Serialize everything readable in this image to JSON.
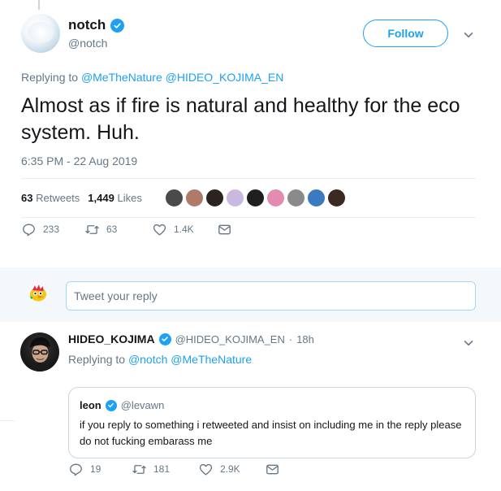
{
  "main_tweet": {
    "display_name": "notch",
    "handle": "@notch",
    "follow_label": "Follow",
    "replying_prefix": "Replying to",
    "replying_mentions": [
      "@MeTheNature",
      "@HIDEO_KOJIMA_EN"
    ],
    "text": "Almost as if fire is natural and healthy for the eco system. Huh.",
    "timestamp": "6:35 PM - 22 Aug 2019",
    "retweets_count": "63",
    "retweets_label": "Retweets",
    "likes_count": "1,449",
    "likes_label": "Likes",
    "reply_count": "233",
    "retweet_action_count": "63",
    "like_action_count": "1.4K",
    "liker_colors": [
      "#4a4a4a",
      "#b07a6a",
      "#2b2320",
      "#c9b8e0",
      "#1f1f1f",
      "#e38bb0",
      "#8a8a8a",
      "#3a7bbf",
      "#3b2a22"
    ]
  },
  "reply_box": {
    "placeholder": "Tweet your reply"
  },
  "reply_tweet": {
    "display_name": "HIDEO_KOJIMA",
    "handle": "@HIDEO_KOJIMA_EN",
    "separator": "·",
    "time": "18h",
    "replying_prefix": "Replying to",
    "replying_mentions": [
      "@notch",
      "@MeTheNature"
    ],
    "reply_count": "19",
    "retweet_count": "181",
    "like_count": "2.9K",
    "quote": {
      "display_name": "leon",
      "handle": "@levawn",
      "text": "if you reply to something i retweeted and insist on including me in the reply please do not fucking embarass me"
    }
  },
  "colors": {
    "accent": "#1da1f2",
    "text": "#14171a",
    "secondary": "#657786",
    "divider": "#e6ecf0"
  }
}
